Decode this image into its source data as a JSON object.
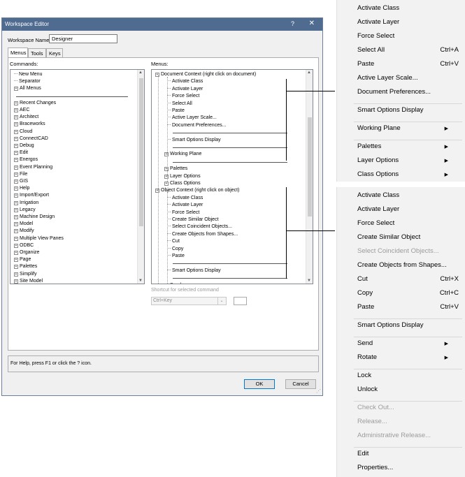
{
  "dialog": {
    "title": "Workspace Editor",
    "help_glyph": "?",
    "close_glyph": "✕",
    "workspace_name_label": "Workspace Name:",
    "workspace_name_value": "Designer",
    "tabs": [
      {
        "label": "Menus"
      },
      {
        "label": "Tools"
      },
      {
        "label": "Keys"
      }
    ],
    "commands_label": "Commands:",
    "menus_label": "Menus:",
    "shortcut_label": "Shortcut for selected command",
    "shortcut_value": "Ctrl+Key",
    "help_text": "For Help, press F1 or click the ? icon.",
    "ok_label": "OK",
    "cancel_label": "Cancel"
  },
  "commands": [
    {
      "label": "New Menu",
      "kind": "leaf"
    },
    {
      "label": "Separator",
      "kind": "leaf"
    },
    {
      "label": "All Menus",
      "kind": "group"
    },
    {
      "label": "",
      "kind": "sep"
    },
    {
      "label": "Recent Changes",
      "kind": "group"
    },
    {
      "label": "AEC",
      "kind": "group"
    },
    {
      "label": "Architect",
      "kind": "group"
    },
    {
      "label": "Braceworks",
      "kind": "group"
    },
    {
      "label": "Cloud",
      "kind": "group"
    },
    {
      "label": "ConnectCAD",
      "kind": "group"
    },
    {
      "label": "Debug",
      "kind": "group"
    },
    {
      "label": "Edit",
      "kind": "group"
    },
    {
      "label": "Energos",
      "kind": "group"
    },
    {
      "label": "Event Planning",
      "kind": "group"
    },
    {
      "label": "File",
      "kind": "group"
    },
    {
      "label": "GIS",
      "kind": "group"
    },
    {
      "label": "Help",
      "kind": "group"
    },
    {
      "label": "Import/Export",
      "kind": "group"
    },
    {
      "label": "Irrigation",
      "kind": "group"
    },
    {
      "label": "Legacy",
      "kind": "group"
    },
    {
      "label": "Machine Design",
      "kind": "group"
    },
    {
      "label": "Model",
      "kind": "group"
    },
    {
      "label": "Modify",
      "kind": "group"
    },
    {
      "label": "Multiple View Panes",
      "kind": "group"
    },
    {
      "label": "ODBC",
      "kind": "group"
    },
    {
      "label": "Organize",
      "kind": "group"
    },
    {
      "label": "Page",
      "kind": "group"
    },
    {
      "label": "Palettes",
      "kind": "group"
    },
    {
      "label": "Simplify",
      "kind": "group"
    },
    {
      "label": "Site Model",
      "kind": "group"
    }
  ],
  "menus_tree": [
    {
      "label": "Document Context (right click on document)",
      "kind": "root"
    },
    {
      "label": "Activate Class",
      "kind": "leaf"
    },
    {
      "label": "Activate Layer",
      "kind": "leaf"
    },
    {
      "label": "Force Select",
      "kind": "leaf"
    },
    {
      "label": "Select All",
      "kind": "leaf"
    },
    {
      "label": "Paste",
      "kind": "leaf"
    },
    {
      "label": "Active Layer Scale...",
      "kind": "leaf"
    },
    {
      "label": "Document Preferences...",
      "kind": "leaf"
    },
    {
      "label": "",
      "kind": "sep"
    },
    {
      "label": "Smart Options Display",
      "kind": "leaf"
    },
    {
      "label": "",
      "kind": "sep"
    },
    {
      "label": "Working Plane",
      "kind": "group"
    },
    {
      "label": "",
      "kind": "sep"
    },
    {
      "label": "Palettes",
      "kind": "group"
    },
    {
      "label": "Layer Options",
      "kind": "group"
    },
    {
      "label": "Class Options",
      "kind": "group"
    },
    {
      "label": "Object Context (right click on object)",
      "kind": "root"
    },
    {
      "label": "Activate Class",
      "kind": "leaf"
    },
    {
      "label": "Activate Layer",
      "kind": "leaf"
    },
    {
      "label": "Force Select",
      "kind": "leaf"
    },
    {
      "label": "Create Similar Object",
      "kind": "leaf"
    },
    {
      "label": "Select Coincident Objects...",
      "kind": "leaf"
    },
    {
      "label": "Create Objects from Shapes...",
      "kind": "leaf"
    },
    {
      "label": "Cut",
      "kind": "leaf"
    },
    {
      "label": "Copy",
      "kind": "leaf"
    },
    {
      "label": "Paste",
      "kind": "leaf"
    },
    {
      "label": "",
      "kind": "sep"
    },
    {
      "label": "Smart Options Display",
      "kind": "leaf"
    },
    {
      "label": "",
      "kind": "sep"
    },
    {
      "label": "Send",
      "kind": "group"
    }
  ],
  "doc_menu": [
    {
      "label": "Activate Class",
      "shortcut": ""
    },
    {
      "label": "Activate Layer",
      "shortcut": ""
    },
    {
      "label": "Force Select",
      "shortcut": ""
    },
    {
      "label": "Select All",
      "shortcut": "Ctrl+A"
    },
    {
      "label": "Paste",
      "shortcut": "Ctrl+V"
    },
    {
      "label": "Active Layer Scale...",
      "shortcut": ""
    },
    {
      "label": "Document Preferences...",
      "shortcut": ""
    },
    {
      "label": "Smart Options Display",
      "shortcut": ""
    },
    {
      "label": "Working Plane",
      "shortcut": "",
      "submenu": true
    },
    {
      "label": "Palettes",
      "shortcut": "",
      "submenu": true
    },
    {
      "label": "Layer Options",
      "shortcut": "",
      "submenu": true
    },
    {
      "label": "Class Options",
      "shortcut": "",
      "submenu": true
    }
  ],
  "obj_menu": [
    {
      "label": "Activate Class",
      "shortcut": ""
    },
    {
      "label": "Activate Layer",
      "shortcut": ""
    },
    {
      "label": "Force Select",
      "shortcut": ""
    },
    {
      "label": "Create Similar Object",
      "shortcut": ""
    },
    {
      "label": "Select Coincident Objects...",
      "shortcut": "",
      "disabled": true
    },
    {
      "label": "Create Objects from Shapes...",
      "shortcut": ""
    },
    {
      "label": "Cut",
      "shortcut": "Ctrl+X"
    },
    {
      "label": "Copy",
      "shortcut": "Ctrl+C"
    },
    {
      "label": "Paste",
      "shortcut": "Ctrl+V"
    },
    {
      "label": "Smart Options Display",
      "shortcut": ""
    },
    {
      "label": "Send",
      "shortcut": "",
      "submenu": true
    },
    {
      "label": "Rotate",
      "shortcut": "",
      "submenu": true
    },
    {
      "label": "Lock",
      "shortcut": ""
    },
    {
      "label": "Unlock",
      "shortcut": ""
    },
    {
      "label": "Check Out...",
      "shortcut": "",
      "disabled": true
    },
    {
      "label": "Release...",
      "shortcut": "",
      "disabled": true
    },
    {
      "label": "Administrative Release...",
      "shortcut": "",
      "disabled": true
    },
    {
      "label": "Edit",
      "shortcut": ""
    },
    {
      "label": "Properties...",
      "shortcut": ""
    }
  ],
  "glyphs": {
    "expand": "+",
    "submenu_arrow": "▶",
    "scroll_up": "▲",
    "scroll_down": "▼",
    "dropdown": "⌄",
    "grip": "⋰"
  }
}
